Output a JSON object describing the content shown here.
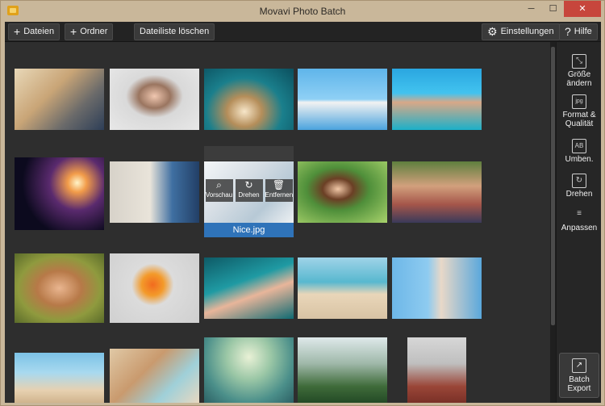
{
  "window": {
    "title": "Movavi Photo Batch",
    "minimize": "─",
    "maximize": "☐",
    "close": "✕"
  },
  "toolbar": {
    "add_files": "Dateien",
    "add_folder": "Ordner",
    "clear_list": "Dateiliste löschen",
    "settings": "Einstellungen",
    "help": "Hilfe"
  },
  "selected_file": {
    "name": "Nice.jpg",
    "actions": [
      "Vorschau",
      "Drehen",
      "Entfernen"
    ]
  },
  "sidebar": {
    "items": [
      {
        "label1": "Größe",
        "label2": "ändern",
        "icon": "⤡"
      },
      {
        "label1": "Format &",
        "label2": "Qualität",
        "icon": "jpg"
      },
      {
        "label1": "Umben.",
        "label2": "",
        "icon": "AB"
      },
      {
        "label1": "Drehen",
        "label2": "",
        "icon": "↻"
      },
      {
        "label1": "Anpassen",
        "label2": "",
        "icon": "≡"
      }
    ],
    "export": {
      "label1": "Batch",
      "label2": "Export",
      "icon": "↗"
    }
  }
}
